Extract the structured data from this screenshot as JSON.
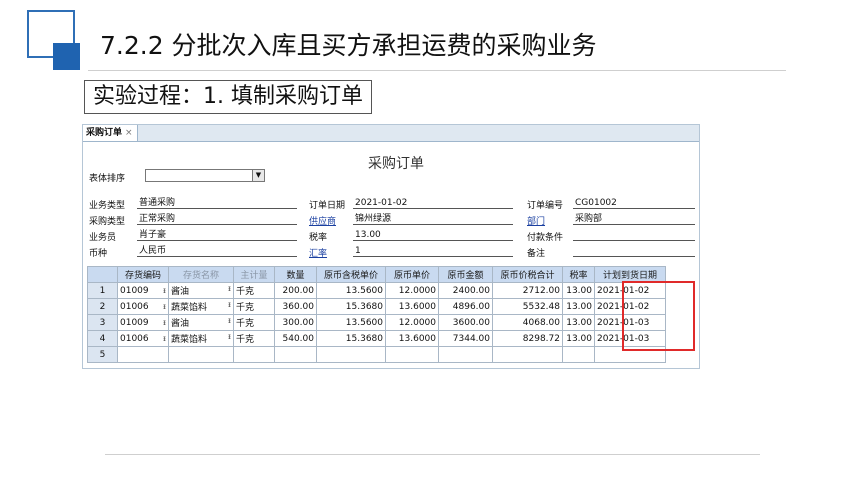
{
  "slide": {
    "title": "7.2.2  分批次入库且买方承担运费的采购业务",
    "subtitle": "实验过程：1. 填制采购订单"
  },
  "window": {
    "tab_label": "采购订单",
    "tab_close": "×",
    "form_title": "采购订单",
    "sort": {
      "label": "表体排序",
      "value": "",
      "arrow": "▼"
    },
    "fields": {
      "business_type": {
        "label": "业务类型",
        "value": "普通采购"
      },
      "order_date": {
        "label": "订单日期",
        "value": "2021-01-02"
      },
      "order_no": {
        "label": "订单编号",
        "value": "CG01002"
      },
      "purchase_type": {
        "label": "采购类型",
        "value": "正常采购"
      },
      "supplier": {
        "label": "供应商",
        "value": "锦州绿源"
      },
      "department": {
        "label": "部门",
        "value": "采购部"
      },
      "salesman": {
        "label": "业务员",
        "value": "肖子豪"
      },
      "tax_rate": {
        "label": "税率",
        "value": "13.00"
      },
      "payment_terms": {
        "label": "付款条件",
        "value": ""
      },
      "currency": {
        "label": "币种",
        "value": "人民币"
      },
      "exchange_rate": {
        "label": "汇率",
        "value": "1"
      },
      "remark": {
        "label": "备注",
        "value": ""
      }
    },
    "table": {
      "headers": [
        "",
        "存货编码",
        "存货名称",
        "主计量",
        "数量",
        "原币含税单价",
        "原币单价",
        "原币金额",
        "原币价税合计",
        "税率",
        "计划到货日期"
      ],
      "rows": [
        [
          "1",
          "01009",
          "酱油",
          "千克",
          "200.00",
          "13.5600",
          "12.0000",
          "2400.00",
          "2712.00",
          "13.00",
          "2021-01-02"
        ],
        [
          "2",
          "01006",
          "蔬菜馅料",
          "千克",
          "360.00",
          "15.3680",
          "13.6000",
          "4896.00",
          "5532.48",
          "13.00",
          "2021-01-02"
        ],
        [
          "3",
          "01009",
          "酱油",
          "千克",
          "300.00",
          "13.5600",
          "12.0000",
          "3600.00",
          "4068.00",
          "13.00",
          "2021-01-03"
        ],
        [
          "4",
          "01006",
          "蔬菜馅料",
          "千克",
          "540.00",
          "15.3680",
          "13.6000",
          "7344.00",
          "8298.72",
          "13.00",
          "2021-01-03"
        ],
        [
          "5",
          "",
          "",
          "",
          "",
          "",
          "",
          "",
          "",
          "",
          ""
        ]
      ]
    }
  },
  "colors": {
    "accent_blue": "#1f63b0",
    "highlight_red": "#e02a2a",
    "header_bg": "#c9daf0"
  }
}
